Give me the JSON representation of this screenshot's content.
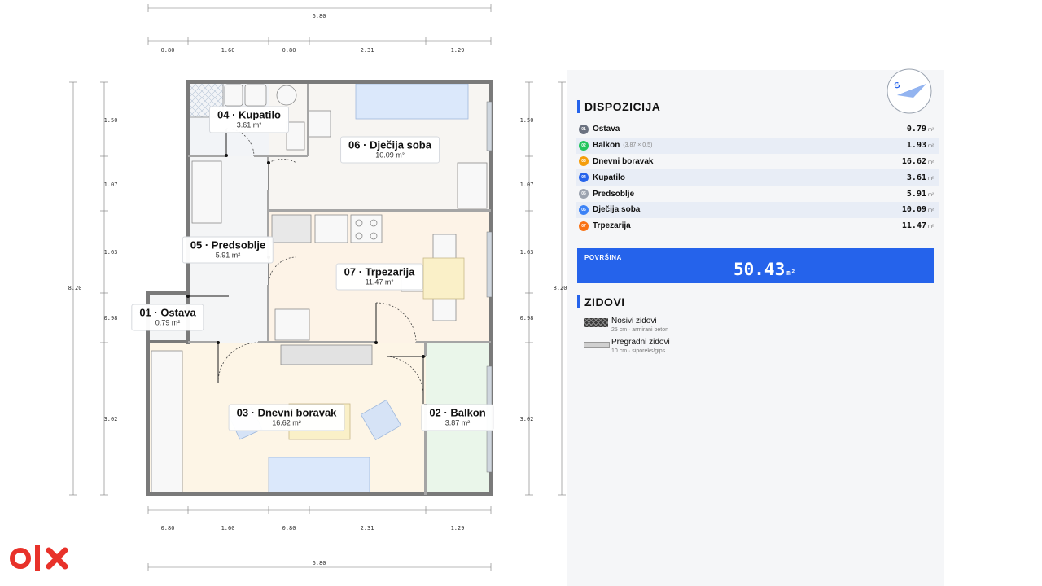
{
  "plan": {
    "dims_top_total": "6.80",
    "dims_bottom_total": "6.80",
    "dims_horizontal": [
      "0.80",
      "1.60",
      "0.80",
      "2.31",
      "1.29"
    ],
    "dims_left_total": "8.20",
    "dims_right_total": "8.20",
    "dims_vertical": [
      "1.50",
      "1.07",
      "1.63",
      "0.98",
      "3.02"
    ],
    "rooms": [
      {
        "id": "04",
        "name": "04 · Kupatilo",
        "area": "3.61 m²"
      },
      {
        "id": "06",
        "name": "06 · Dječija soba",
        "area": "10.09 m²"
      },
      {
        "id": "05",
        "name": "05 · Predsoblje",
        "area": "5.91 m²"
      },
      {
        "id": "07",
        "name": "07 · Trpezarija",
        "area": "11.47 m²"
      },
      {
        "id": "01",
        "name": "01 · Ostava",
        "area": "0.79 m²"
      },
      {
        "id": "03",
        "name": "03 · Dnevni boravak",
        "area": "16.62 m²"
      },
      {
        "id": "02",
        "name": "02 · Balkon",
        "area": "3.87 m²"
      }
    ]
  },
  "panel": {
    "compass_letter": "S",
    "dispozicija_title": "DISPOZICIJA",
    "rooms": [
      {
        "num": "01",
        "name": "Ostava",
        "note": "",
        "value": "0.79",
        "unit": "m²",
        "color": "#6b7280"
      },
      {
        "num": "02",
        "name": "Balkon",
        "note": "(3.87 × 0.5)",
        "value": "1.93",
        "unit": "m²",
        "color": "#22c55e"
      },
      {
        "num": "03",
        "name": "Dnevni boravak",
        "note": "",
        "value": "16.62",
        "unit": "m²",
        "color": "#f59e0b"
      },
      {
        "num": "04",
        "name": "Kupatilo",
        "note": "",
        "value": "3.61",
        "unit": "m²",
        "color": "#2563eb"
      },
      {
        "num": "05",
        "name": "Predsoblje",
        "note": "",
        "value": "5.91",
        "unit": "m²",
        "color": "#9ca3af"
      },
      {
        "num": "06",
        "name": "Dječija soba",
        "note": "",
        "value": "10.09",
        "unit": "m²",
        "color": "#3b82f6"
      },
      {
        "num": "07",
        "name": "Trpezarija",
        "note": "",
        "value": "11.47",
        "unit": "m²",
        "color": "#f97316"
      }
    ],
    "total_label": "POVRŠINA",
    "total_value": "50.43",
    "total_unit": "m²",
    "zidovi_title": "ZIDOVI",
    "walls": [
      {
        "name": "Nosivi zidovi",
        "sub": "25 cm · armirani beton"
      },
      {
        "name": "Pregradni zidovi",
        "sub": "10 cm · siporeks/gips"
      }
    ]
  },
  "colors": {
    "accent": "#2563eb",
    "logo": "#e8322a"
  }
}
